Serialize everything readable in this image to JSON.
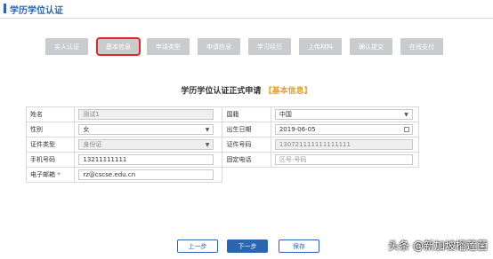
{
  "header": {
    "title": "学历学位认证"
  },
  "steps": [
    "实人认证",
    "基本信息",
    "申请类型",
    "申请信息",
    "学习经历",
    "上传材料",
    "确认提交",
    "在线支付"
  ],
  "active_step": "基本信息",
  "form": {
    "title": "学历学位认证正式申请",
    "tag": "【基本信息】",
    "name_label": "姓名",
    "name_value": "测试1",
    "nationality_label": "国籍",
    "nationality_value": "中国",
    "gender_label": "性别",
    "gender_value": "女",
    "birth_label": "出生日期",
    "birth_value": "2019-06-05",
    "idtype_label": "证件类型",
    "idtype_value": "身份证",
    "idnum_label": "证件号码",
    "idnum_value": "130721111111111111",
    "mobile_label": "手机号码",
    "mobile_value": "13211111111",
    "phone_label": "固定电话",
    "phone_placeholder": "区号-号码",
    "email_label": "电子邮箱",
    "email_required": "*",
    "email_value": "rz@cscse.edu.cn"
  },
  "buttons": {
    "prev": "上一步",
    "next": "下一步",
    "save": "保存"
  },
  "watermark": "头条 @新加坡榴莲菌",
  "colors": {
    "accent": "#2b66b1",
    "tag": "#f29c1f",
    "active_border": "#e0262b"
  }
}
